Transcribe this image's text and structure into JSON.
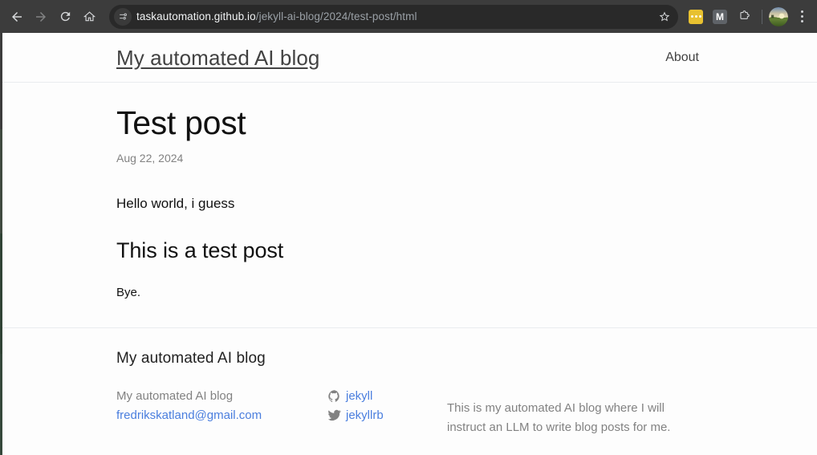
{
  "browser": {
    "nav": {
      "back_label": "Back",
      "forward_label": "Forward",
      "reload_label": "Reload",
      "home_label": "Home"
    },
    "omnibox": {
      "site_info_icon": "site-settings-icon",
      "url_host": "taskautomation.github.io",
      "url_path": "/jekyll-ai-blog/2024/test-post/html",
      "url_full": "taskautomation.github.io/jekyll-ai-blog/2024/test-post/html",
      "bookmark_icon": "star-icon",
      "background": "#292929"
    },
    "toolbar": {
      "extension_1": {
        "icon": "speech-dots-extension-icon",
        "color": "#e8c130"
      },
      "extension_2": {
        "icon": "letter-m-extension-icon",
        "label": "M",
        "color": "#5f6368"
      },
      "extensions_puzzle_icon": "puzzle-piece-icon",
      "profile_icon": "avatar-photo",
      "menu_icon": "three-dot-menu-icon"
    },
    "chrome_background": "#3c3c3c"
  },
  "site": {
    "title": "My automated AI blog",
    "nav": [
      {
        "label": "About"
      }
    ]
  },
  "post": {
    "title": "Test post",
    "date": "Aug 22, 2024",
    "blocks": [
      {
        "type": "p",
        "text": "Hello world, i guess"
      },
      {
        "type": "h2",
        "text": "This is a test post"
      },
      {
        "type": "p_small",
        "text": "Bye."
      }
    ],
    "paragraph_1": "Hello world, i guess",
    "heading_1": "This is a test post",
    "paragraph_2": "Bye."
  },
  "footer": {
    "heading": "My automated AI blog",
    "contact": {
      "name": "My automated AI blog",
      "email": "fredrikskatland@gmail.com"
    },
    "social": [
      {
        "icon": "github-icon",
        "label": "jekyll"
      },
      {
        "icon": "twitter-icon",
        "label": "jekyllrb"
      }
    ],
    "description": "This is my automated AI blog where I will instruct an LLM to write blog posts for me."
  },
  "colors": {
    "link": "#4a7ede",
    "muted_text": "#828282",
    "body_text": "#111111",
    "page_background": "#fdfdfd",
    "border": "#eaecef"
  }
}
